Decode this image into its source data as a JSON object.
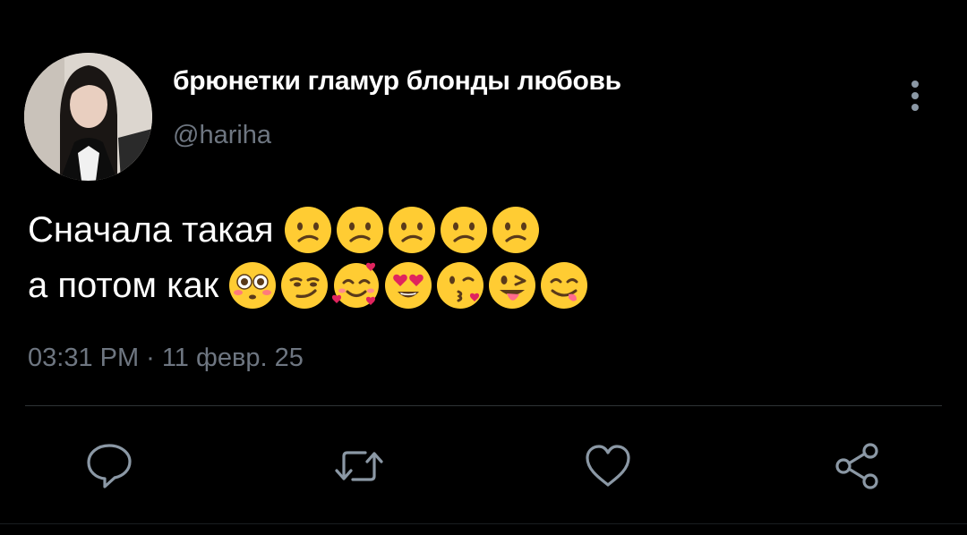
{
  "tweet": {
    "display_name": "брюнетки гламур блонды любовь",
    "handle": "@hariha",
    "text_line_1": "Сначала такая",
    "text_line_2": "а потом как",
    "line_1_emojis": [
      "confused-face",
      "confused-face",
      "confused-face",
      "confused-face",
      "confused-face"
    ],
    "line_2_emojis": [
      "flushed-face",
      "smirking-face",
      "smiling-face-with-hearts",
      "heart-eyes-face",
      "face-blowing-kiss",
      "winking-face-with-tongue",
      "face-savoring-food"
    ],
    "time": "03:31 PM",
    "separator": "·",
    "date": "11 февр. 25"
  },
  "actions": {
    "reply_icon": "reply-icon",
    "retweet_icon": "retweet-icon",
    "like_icon": "heart-icon",
    "share_icon": "share-icon",
    "more_icon": "more-vertical-icon"
  },
  "colors": {
    "background": "#000000",
    "text_primary": "#ffffff",
    "text_secondary": "#6e7681",
    "divider": "#2f3336",
    "icon": "#8b98a5",
    "emoji_yellow": "#ffcc33"
  }
}
